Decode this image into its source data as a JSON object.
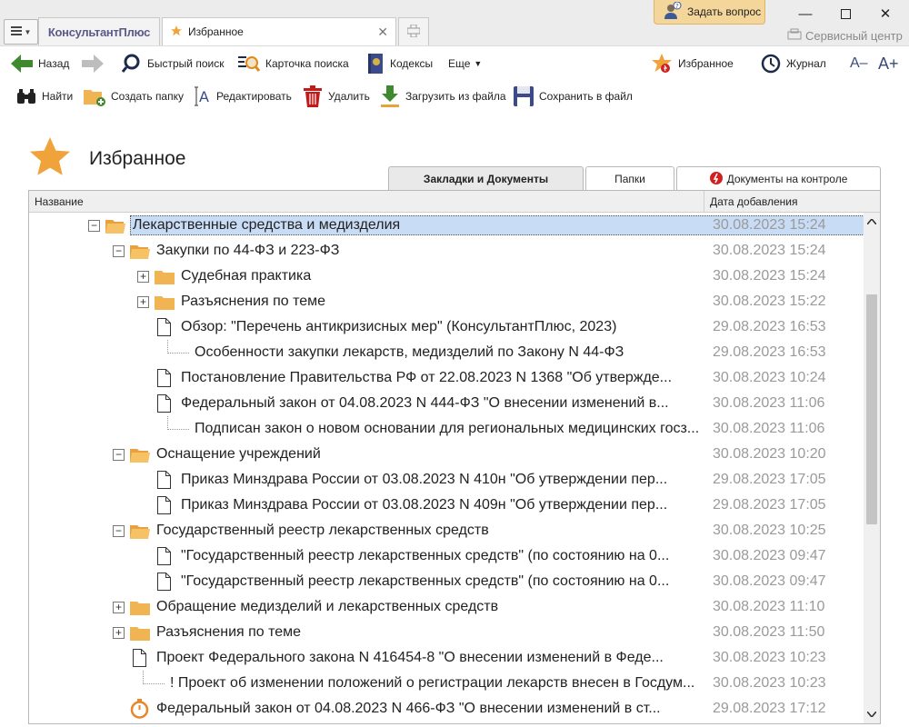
{
  "titlebar": {
    "brand": "КонсультантПлюс",
    "active_tab": "Избранное",
    "ask_question": "Задать вопрос",
    "service_center": "Сервисный центр"
  },
  "toolbar1": {
    "back": "Назад",
    "quick_search": "Быстрый поиск",
    "search_card": "Карточка поиска",
    "codes": "Кодексы",
    "more": "Еще",
    "favorites": "Избранное",
    "journal": "Журнал",
    "font_smaller": "A–",
    "font_larger": "A+"
  },
  "toolbar2": {
    "find": "Найти",
    "create_folder": "Создать папку",
    "edit": "Редактировать",
    "delete": "Удалить",
    "load": "Загрузить из файла",
    "save": "Сохранить в файл"
  },
  "page": {
    "title": "Избранное",
    "tabs": [
      "Закладки и Документы",
      "Папки",
      "Документы на контроле"
    ]
  },
  "grid": {
    "col_name": "Название",
    "col_date": "Дата добавления",
    "rows": [
      {
        "text": "Лекарственные средства и медизделия",
        "date": "30.08.2023 15:24",
        "kind": "folder",
        "expand": "−",
        "selected": true
      },
      {
        "text": "Закупки по 44-ФЗ и 223-ФЗ",
        "date": "30.08.2023 15:24",
        "kind": "folder",
        "expand": "−"
      },
      {
        "text": "Судебная практика",
        "date": "30.08.2023 15:24",
        "kind": "folder",
        "expand": "+"
      },
      {
        "text": "Разъяснения по теме",
        "date": "30.08.2023 15:22",
        "kind": "folder",
        "expand": "+"
      },
      {
        "text": "Обзор: \"Перечень антикризисных мер\" (КонсультантПлюс, 2023)",
        "date": "29.08.2023 16:53",
        "kind": "doc"
      },
      {
        "text": "Особенности закупки лекарств, медизделий по Закону N 44-ФЗ",
        "date": "29.08.2023 16:53",
        "kind": "bookmark"
      },
      {
        "text": "Постановление Правительства РФ от 22.08.2023 N 1368 \"Об утвержде...",
        "date": "30.08.2023 10:24",
        "kind": "doc"
      },
      {
        "text": "Федеральный закон от 04.08.2023 N 444-ФЗ \"О внесении изменений в...",
        "date": "30.08.2023 11:06",
        "kind": "doc"
      },
      {
        "text": "Подписан закон о новом основании для региональных медицинских госз...",
        "date": "30.08.2023 11:06",
        "kind": "bookmark"
      },
      {
        "text": "Оснащение учреждений",
        "date": "30.08.2023 10:20",
        "kind": "folder",
        "expand": "−"
      },
      {
        "text": "Приказ Минздрава России от 03.08.2023 N 410н \"Об утверждении пер...",
        "date": "29.08.2023 17:05",
        "kind": "doc"
      },
      {
        "text": "Приказ Минздрава России от 03.08.2023 N 409н \"Об утверждении пер...",
        "date": "29.08.2023 17:05",
        "kind": "doc"
      },
      {
        "text": "Государственный реестр лекарственных средств",
        "date": "30.08.2023 10:25",
        "kind": "folder",
        "expand": "−"
      },
      {
        "text": "\"Государственный реестр лекарственных средств\" (по состоянию на 0...",
        "date": "30.08.2023 09:47",
        "kind": "doc"
      },
      {
        "text": "\"Государственный реестр лекарственных средств\" (по состоянию на 0...",
        "date": "30.08.2023 09:47",
        "kind": "doc"
      },
      {
        "text": "Обращение медизделий и лекарственных средств",
        "date": "30.08.2023 11:10",
        "kind": "folder",
        "expand": "+"
      },
      {
        "text": "Разъяснения по теме",
        "date": "30.08.2023 11:50",
        "kind": "folder",
        "expand": "+"
      },
      {
        "text": "Проект Федерального закона N 416454-8 \"О внесении изменений в Феде...",
        "date": "30.08.2023 10:23",
        "kind": "doc"
      },
      {
        "text": "! Проект об изменении положений о регистрации лекарств внесен в Госдум...",
        "date": "30.08.2023 10:23",
        "kind": "bookmark"
      },
      {
        "text": "Федеральный закон от 04.08.2023 N 466-ФЗ \"О внесении изменений в ст...",
        "date": "29.08.2023 17:12",
        "kind": "timer"
      }
    ]
  }
}
